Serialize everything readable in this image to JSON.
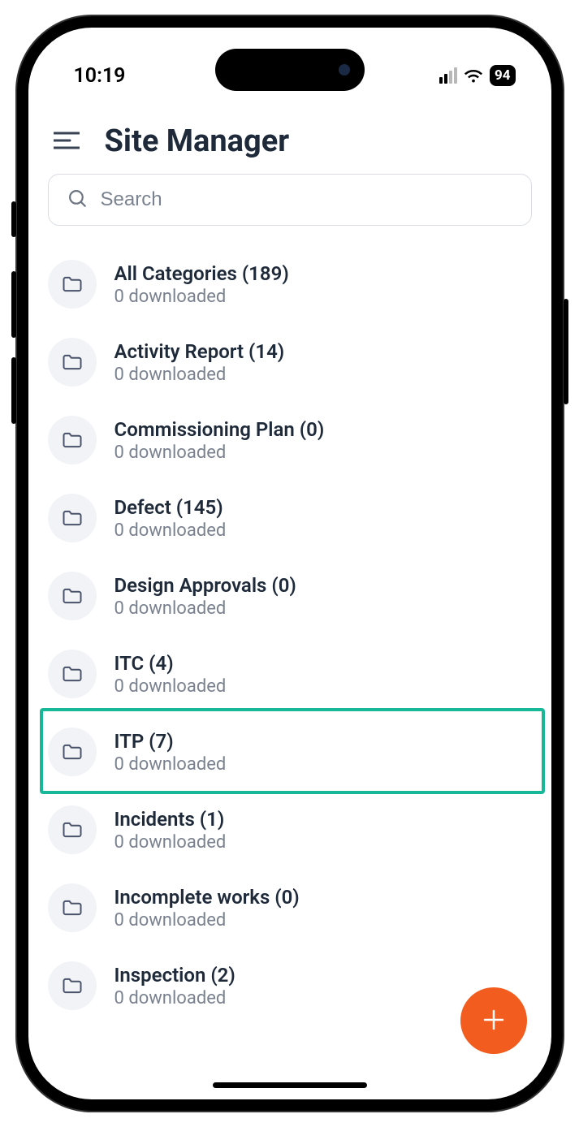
{
  "status": {
    "time": "10:19",
    "battery": "94"
  },
  "header": {
    "title": "Site Manager"
  },
  "search": {
    "placeholder": "Search"
  },
  "highlighted_index": 6,
  "categories": [
    {
      "title": "All Categories (189)",
      "subtitle": "0 downloaded"
    },
    {
      "title": "Activity Report (14)",
      "subtitle": "0 downloaded"
    },
    {
      "title": "Commissioning Plan (0)",
      "subtitle": "0 downloaded"
    },
    {
      "title": "Defect (145)",
      "subtitle": "0 downloaded"
    },
    {
      "title": "Design Approvals (0)",
      "subtitle": "0 downloaded"
    },
    {
      "title": "ITC (4)",
      "subtitle": "0 downloaded"
    },
    {
      "title": "ITP (7)",
      "subtitle": "0 downloaded"
    },
    {
      "title": "Incidents (1)",
      "subtitle": "0 downloaded"
    },
    {
      "title": "Incomplete works (0)",
      "subtitle": "0 downloaded"
    },
    {
      "title": "Inspection (2)",
      "subtitle": "0 downloaded"
    }
  ]
}
